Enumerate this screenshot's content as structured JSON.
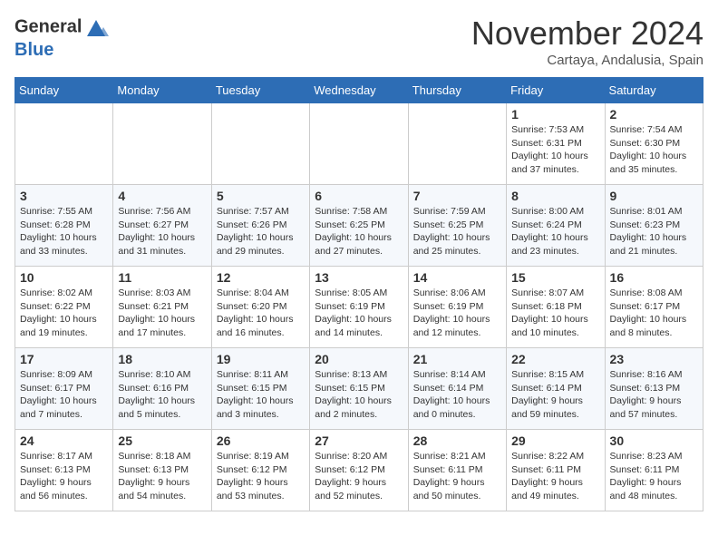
{
  "header": {
    "logo_line1": "General",
    "logo_line2": "Blue",
    "month": "November 2024",
    "location": "Cartaya, Andalusia, Spain"
  },
  "weekdays": [
    "Sunday",
    "Monday",
    "Tuesday",
    "Wednesday",
    "Thursday",
    "Friday",
    "Saturday"
  ],
  "weeks": [
    [
      {
        "day": "",
        "info": ""
      },
      {
        "day": "",
        "info": ""
      },
      {
        "day": "",
        "info": ""
      },
      {
        "day": "",
        "info": ""
      },
      {
        "day": "",
        "info": ""
      },
      {
        "day": "1",
        "info": "Sunrise: 7:53 AM\nSunset: 6:31 PM\nDaylight: 10 hours and 37 minutes."
      },
      {
        "day": "2",
        "info": "Sunrise: 7:54 AM\nSunset: 6:30 PM\nDaylight: 10 hours and 35 minutes."
      }
    ],
    [
      {
        "day": "3",
        "info": "Sunrise: 7:55 AM\nSunset: 6:28 PM\nDaylight: 10 hours and 33 minutes."
      },
      {
        "day": "4",
        "info": "Sunrise: 7:56 AM\nSunset: 6:27 PM\nDaylight: 10 hours and 31 minutes."
      },
      {
        "day": "5",
        "info": "Sunrise: 7:57 AM\nSunset: 6:26 PM\nDaylight: 10 hours and 29 minutes."
      },
      {
        "day": "6",
        "info": "Sunrise: 7:58 AM\nSunset: 6:25 PM\nDaylight: 10 hours and 27 minutes."
      },
      {
        "day": "7",
        "info": "Sunrise: 7:59 AM\nSunset: 6:25 PM\nDaylight: 10 hours and 25 minutes."
      },
      {
        "day": "8",
        "info": "Sunrise: 8:00 AM\nSunset: 6:24 PM\nDaylight: 10 hours and 23 minutes."
      },
      {
        "day": "9",
        "info": "Sunrise: 8:01 AM\nSunset: 6:23 PM\nDaylight: 10 hours and 21 minutes."
      }
    ],
    [
      {
        "day": "10",
        "info": "Sunrise: 8:02 AM\nSunset: 6:22 PM\nDaylight: 10 hours and 19 minutes."
      },
      {
        "day": "11",
        "info": "Sunrise: 8:03 AM\nSunset: 6:21 PM\nDaylight: 10 hours and 17 minutes."
      },
      {
        "day": "12",
        "info": "Sunrise: 8:04 AM\nSunset: 6:20 PM\nDaylight: 10 hours and 16 minutes."
      },
      {
        "day": "13",
        "info": "Sunrise: 8:05 AM\nSunset: 6:19 PM\nDaylight: 10 hours and 14 minutes."
      },
      {
        "day": "14",
        "info": "Sunrise: 8:06 AM\nSunset: 6:19 PM\nDaylight: 10 hours and 12 minutes."
      },
      {
        "day": "15",
        "info": "Sunrise: 8:07 AM\nSunset: 6:18 PM\nDaylight: 10 hours and 10 minutes."
      },
      {
        "day": "16",
        "info": "Sunrise: 8:08 AM\nSunset: 6:17 PM\nDaylight: 10 hours and 8 minutes."
      }
    ],
    [
      {
        "day": "17",
        "info": "Sunrise: 8:09 AM\nSunset: 6:17 PM\nDaylight: 10 hours and 7 minutes."
      },
      {
        "day": "18",
        "info": "Sunrise: 8:10 AM\nSunset: 6:16 PM\nDaylight: 10 hours and 5 minutes."
      },
      {
        "day": "19",
        "info": "Sunrise: 8:11 AM\nSunset: 6:15 PM\nDaylight: 10 hours and 3 minutes."
      },
      {
        "day": "20",
        "info": "Sunrise: 8:13 AM\nSunset: 6:15 PM\nDaylight: 10 hours and 2 minutes."
      },
      {
        "day": "21",
        "info": "Sunrise: 8:14 AM\nSunset: 6:14 PM\nDaylight: 10 hours and 0 minutes."
      },
      {
        "day": "22",
        "info": "Sunrise: 8:15 AM\nSunset: 6:14 PM\nDaylight: 9 hours and 59 minutes."
      },
      {
        "day": "23",
        "info": "Sunrise: 8:16 AM\nSunset: 6:13 PM\nDaylight: 9 hours and 57 minutes."
      }
    ],
    [
      {
        "day": "24",
        "info": "Sunrise: 8:17 AM\nSunset: 6:13 PM\nDaylight: 9 hours and 56 minutes."
      },
      {
        "day": "25",
        "info": "Sunrise: 8:18 AM\nSunset: 6:13 PM\nDaylight: 9 hours and 54 minutes."
      },
      {
        "day": "26",
        "info": "Sunrise: 8:19 AM\nSunset: 6:12 PM\nDaylight: 9 hours and 53 minutes."
      },
      {
        "day": "27",
        "info": "Sunrise: 8:20 AM\nSunset: 6:12 PM\nDaylight: 9 hours and 52 minutes."
      },
      {
        "day": "28",
        "info": "Sunrise: 8:21 AM\nSunset: 6:11 PM\nDaylight: 9 hours and 50 minutes."
      },
      {
        "day": "29",
        "info": "Sunrise: 8:22 AM\nSunset: 6:11 PM\nDaylight: 9 hours and 49 minutes."
      },
      {
        "day": "30",
        "info": "Sunrise: 8:23 AM\nSunset: 6:11 PM\nDaylight: 9 hours and 48 minutes."
      }
    ]
  ]
}
